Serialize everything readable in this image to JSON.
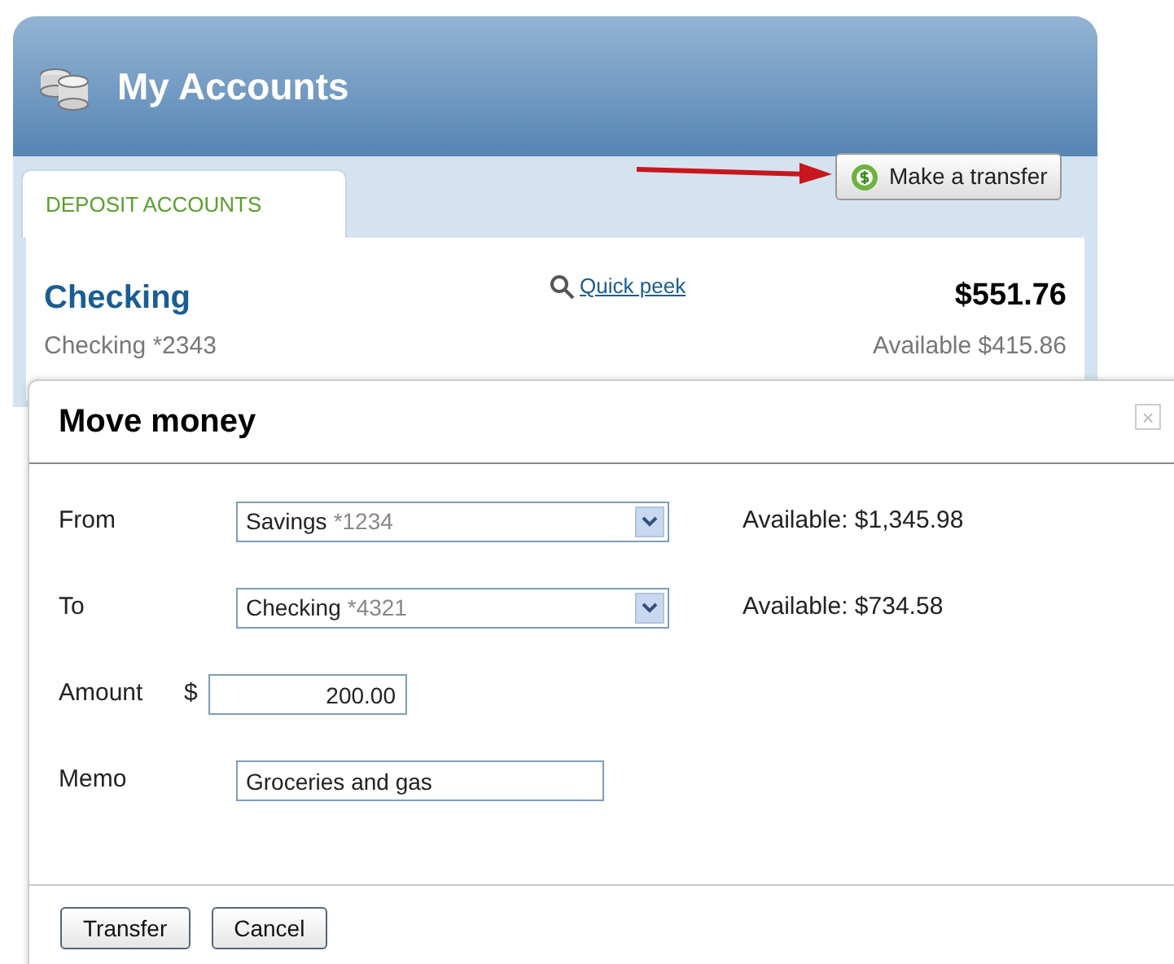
{
  "accounts_panel": {
    "title": "My Accounts",
    "tabs": [
      {
        "label": "DEPOSIT ACCOUNTS",
        "selected": true
      }
    ],
    "transfer_button": "Make a transfer",
    "account": {
      "name": "Checking",
      "number": "Checking *2343",
      "quick_peek": "Quick peek",
      "balance": "$551.76",
      "available": "Available $415.86"
    }
  },
  "dialog": {
    "title": "Move money",
    "close": "×",
    "fields": [
      {
        "kind": "select",
        "label": "From",
        "value": "Savings",
        "account": "*1234",
        "available": "Available: $1,345.98"
      },
      {
        "kind": "select",
        "label": "To",
        "value": "Checking",
        "account": "*4321",
        "available": "Available: $734.58"
      },
      {
        "kind": "amount",
        "label": "Amount",
        "prefix": "$",
        "value": "200.00"
      },
      {
        "kind": "text",
        "label": "Memo",
        "value": "Groceries and gas"
      }
    ],
    "buttons": [
      "Transfer",
      "Cancel"
    ]
  }
}
